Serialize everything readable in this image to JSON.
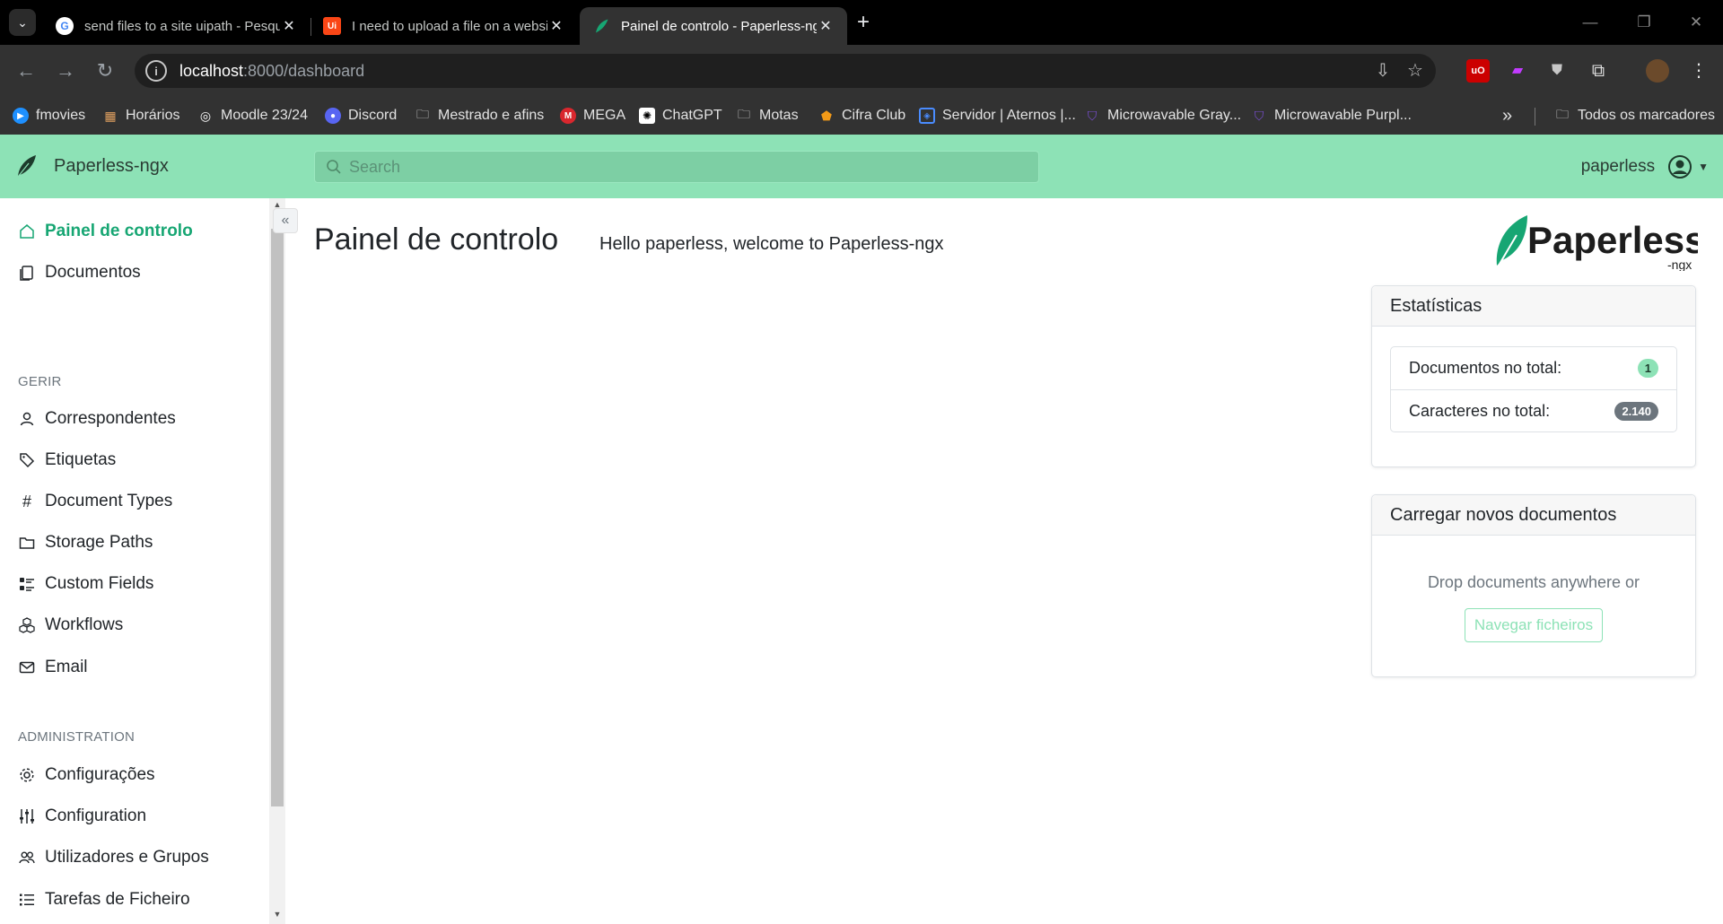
{
  "browser": {
    "tabs": [
      {
        "title": "send files to a site uipath - Pesquisa Google",
        "favicon": "G"
      },
      {
        "title": "I need to upload a file on a website",
        "favicon": "Ui"
      },
      {
        "title": "Painel de controlo - Paperless-ngx",
        "favicon": "leaf"
      }
    ],
    "url_host": "localhost",
    "url_path": ":8000/dashboard",
    "bookmarks": [
      "fmovies",
      "Horários",
      "Moodle 23/24",
      "Discord",
      "Mestrado e afins",
      "MEGA",
      "ChatGPT",
      "Motas",
      "Cifra Club",
      "Servidor | Aternos |...",
      "Microwavable Gray...",
      "Microwavable Purpl...",
      "Todos os marcadores"
    ],
    "more_bookmarks": "»"
  },
  "app": {
    "brand": "Paperless-ngx",
    "search_placeholder": "Search",
    "username": "paperless"
  },
  "sidebar": {
    "items": [
      "Painel de controlo",
      "Documentos"
    ],
    "manage_heading": "GERIR",
    "manage_items": [
      "Correspondentes",
      "Etiquetas",
      "Document Types",
      "Storage Paths",
      "Custom Fields",
      "Workflows",
      "Email"
    ],
    "admin_heading": "ADMINISTRATION",
    "admin_items": [
      "Configurações",
      "Configuration",
      "Utilizadores e Grupos",
      "Tarefas de Ficheiro"
    ]
  },
  "main": {
    "title": "Painel de controlo",
    "welcome": "Hello paperless, welcome to Paperless-ngx",
    "logo_text": "Paperless",
    "logo_sub": "-ngx",
    "stats": {
      "title": "Estatísticas",
      "rows": [
        {
          "label": "Documentos no total:",
          "value": "1"
        },
        {
          "label": "Caracteres no total:",
          "value": "2.140"
        }
      ]
    },
    "upload": {
      "title": "Carregar novos documentos",
      "drop_text": "Drop documents anywhere or",
      "browse_label": "Navegar ficheiros"
    }
  },
  "colors": {
    "accent": "#8de2b6",
    "active_nav": "#17a673"
  }
}
